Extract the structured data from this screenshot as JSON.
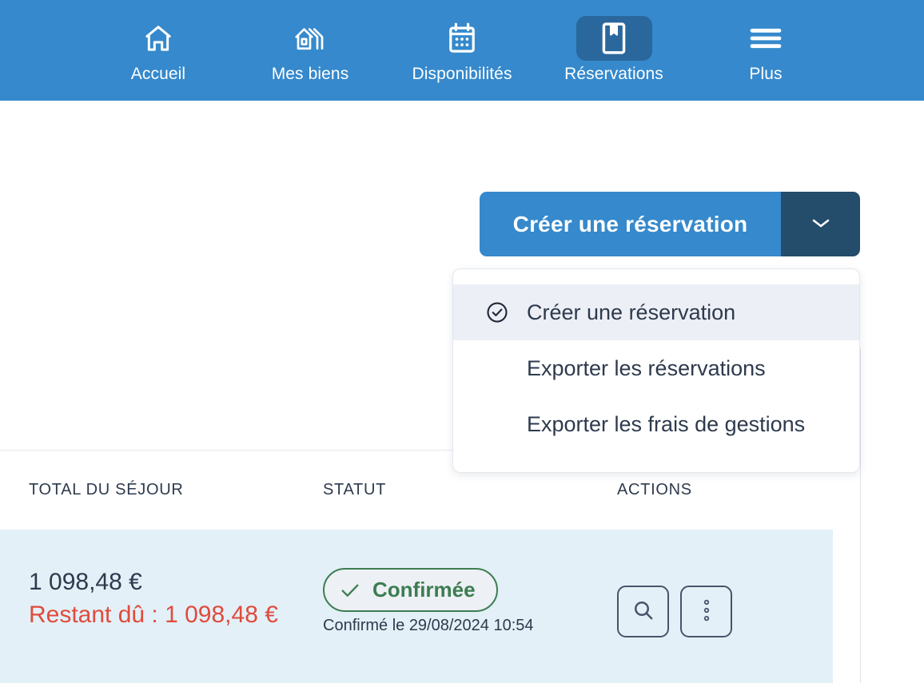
{
  "nav": {
    "items": [
      {
        "label": "Accueil",
        "icon": "home-icon",
        "active": false
      },
      {
        "label": "Mes biens",
        "icon": "properties-icon",
        "active": false
      },
      {
        "label": "Disponibilités",
        "icon": "calendar-icon",
        "active": false
      },
      {
        "label": "Réservations",
        "icon": "bookmark-book-icon",
        "active": true
      },
      {
        "label": "Plus",
        "icon": "hamburger-icon",
        "active": false
      }
    ],
    "background_color": "#3589cc",
    "active_background_color": "#2a679c",
    "text_color": "#ffffff"
  },
  "primary_action": {
    "label": "Créer une réservation",
    "toggle_icon": "chevron-down-icon",
    "main_color": "#3589cc",
    "toggle_color": "#244c6b"
  },
  "dropdown": {
    "open": true,
    "items": [
      {
        "label": "Créer une réservation",
        "icon": "check-circle-icon",
        "selected": true
      },
      {
        "label": "Exporter les réservations",
        "icon": "",
        "selected": false
      },
      {
        "label": "Exporter les frais de gestions",
        "icon": "",
        "selected": false
      }
    ],
    "selected_background_color": "#eceff5"
  },
  "table": {
    "headers": [
      "TOTAL DU SÉJOUR",
      "STATUT",
      "ACTIONS"
    ],
    "rows": [
      {
        "total_amount": "1 098,48 €",
        "total_due": "Restant dû : 1 098,48 €",
        "status_label": "Confirmée",
        "status_icon": "check-icon",
        "status_sub": "Confirmé le 29/08/2024 10:54",
        "actions": [
          {
            "icon": "search-icon",
            "name": "view-button"
          },
          {
            "icon": "kebab-menu-icon",
            "name": "more-actions-button"
          }
        ],
        "row_background_color": "#e3f0f7",
        "status_color": "#3c7d51",
        "due_color": "#e04b3c"
      }
    ]
  }
}
